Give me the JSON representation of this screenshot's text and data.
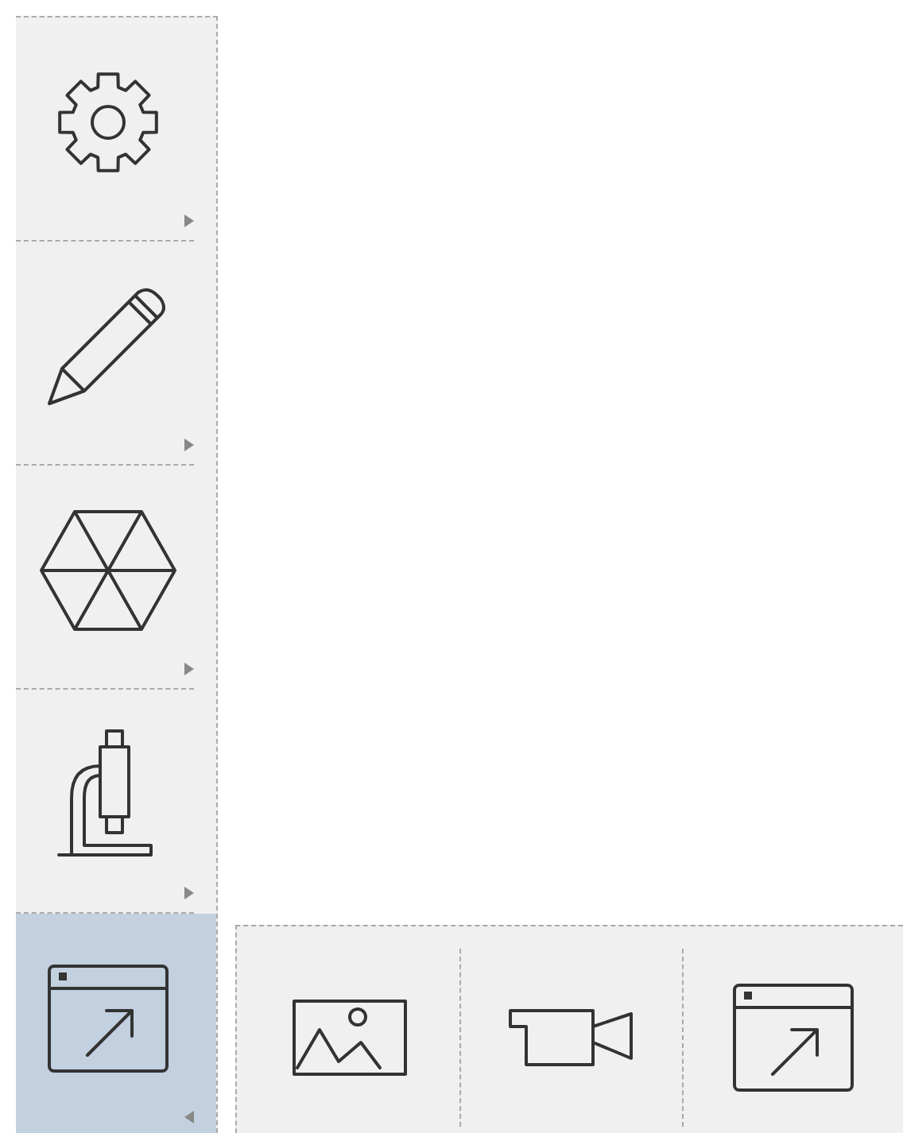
{
  "toolbar": {
    "items": [
      {
        "kind": "gear",
        "selected": false
      },
      {
        "kind": "pencil",
        "selected": false
      },
      {
        "kind": "hexagon",
        "selected": false
      },
      {
        "kind": "microscope",
        "selected": false
      },
      {
        "kind": "window-arrow",
        "selected": true
      }
    ]
  },
  "flyout": {
    "items": [
      {
        "kind": "image"
      },
      {
        "kind": "video"
      },
      {
        "kind": "window-arrow"
      }
    ]
  }
}
